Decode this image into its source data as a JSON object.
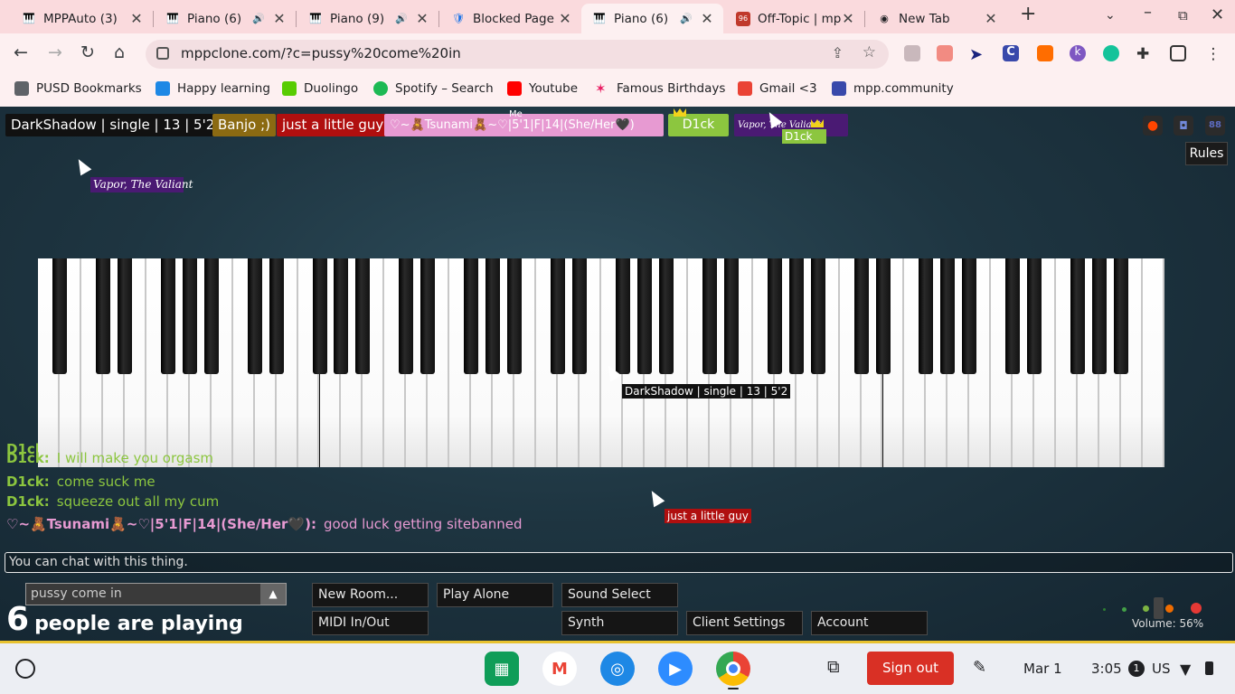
{
  "browser": {
    "tabs": [
      {
        "title": "MPPAuto (3)",
        "icon": "piano-icon",
        "audio": false,
        "active": false
      },
      {
        "title": "Piano (6)",
        "icon": "piano-icon",
        "audio": true,
        "active": false
      },
      {
        "title": "Piano (9)",
        "icon": "piano-icon",
        "audio": true,
        "active": false
      },
      {
        "title": "Blocked Page",
        "icon": "shield-icon",
        "audio": false,
        "active": false
      },
      {
        "title": "Piano (6)",
        "icon": "piano-icon",
        "audio": true,
        "active": true
      },
      {
        "title": "Off-Topic | mp",
        "icon": "forum-icon",
        "audio": false,
        "active": false
      },
      {
        "title": "New Tab",
        "icon": "chrome-icon",
        "audio": false,
        "active": false
      }
    ],
    "url": "mppclone.com/?c=pussy%20come%20in",
    "bookmarks": [
      "PUSD Bookmarks",
      "Happy learning",
      "Duolingo",
      "Spotify – Search",
      "Youtube",
      "Famous Birthdays",
      "Gmail <3",
      "mpp.community"
    ]
  },
  "mpp": {
    "users": [
      {
        "name": "DarkShadow | single | 13 | 5'2",
        "bg": "#111111",
        "fg": "#ffffff"
      },
      {
        "name": "Banjo ;)",
        "bg": "#8b6a12",
        "fg": "#ffffff"
      },
      {
        "name": "just a little guy",
        "bg": "#b00f0f",
        "fg": "#ffffff"
      },
      {
        "name": "♡~🧸Tsunami🧸~♡|5'1|F|14|(She/Her🖤)",
        "bg": "#e79ad2",
        "fg": "#ffffff"
      },
      {
        "name": "D1ck",
        "bg": "#8cc63f",
        "fg": "#ffffff"
      },
      {
        "name": "Vapor, The Valiant",
        "bg": "#4a1a73",
        "fg": "#ffffff"
      }
    ],
    "me_label": "Me",
    "cursors": [
      {
        "label": "Vapor, The Valiant"
      },
      {
        "label": "D1ck"
      },
      {
        "label": "DarkShadow | single | 13 | 5'2"
      },
      {
        "label": "just a little guy"
      }
    ],
    "rules_label": "Rules",
    "chat": [
      {
        "name": "D1ck:",
        "text": "",
        "color": "#8cc63f"
      },
      {
        "name": "D1ck:",
        "text": "I will make you orgasm",
        "color": "#8cc63f"
      },
      {
        "name": "D1ck:",
        "text": "come suck me",
        "color": "#8cc63f"
      },
      {
        "name": "D1ck:",
        "text": "squeeze out all my cum",
        "color": "#8cc63f"
      },
      {
        "name": "♡~🧸Tsunami🧸~♡|5'1|F|14|(She/Her🖤):",
        "text": "good luck getting sitebanned",
        "color": "#e79ad2"
      }
    ],
    "chat_placeholder": "You can chat with this thing.",
    "room_name": "pussy come in",
    "player_count": "6",
    "players_label": "people are playing",
    "buttons": {
      "new_room": "New Room...",
      "play_alone": "Play Alone",
      "sound_select": "Sound Select",
      "midi": "MIDI In/Out",
      "synth": "Synth",
      "client_settings": "Client Settings",
      "account": "Account"
    },
    "volume_label": "Volume: 56%"
  },
  "shelf": {
    "sign_out": "Sign out",
    "date": "Mar 1",
    "time": "3:05",
    "notifications": "1",
    "locale": "US"
  }
}
